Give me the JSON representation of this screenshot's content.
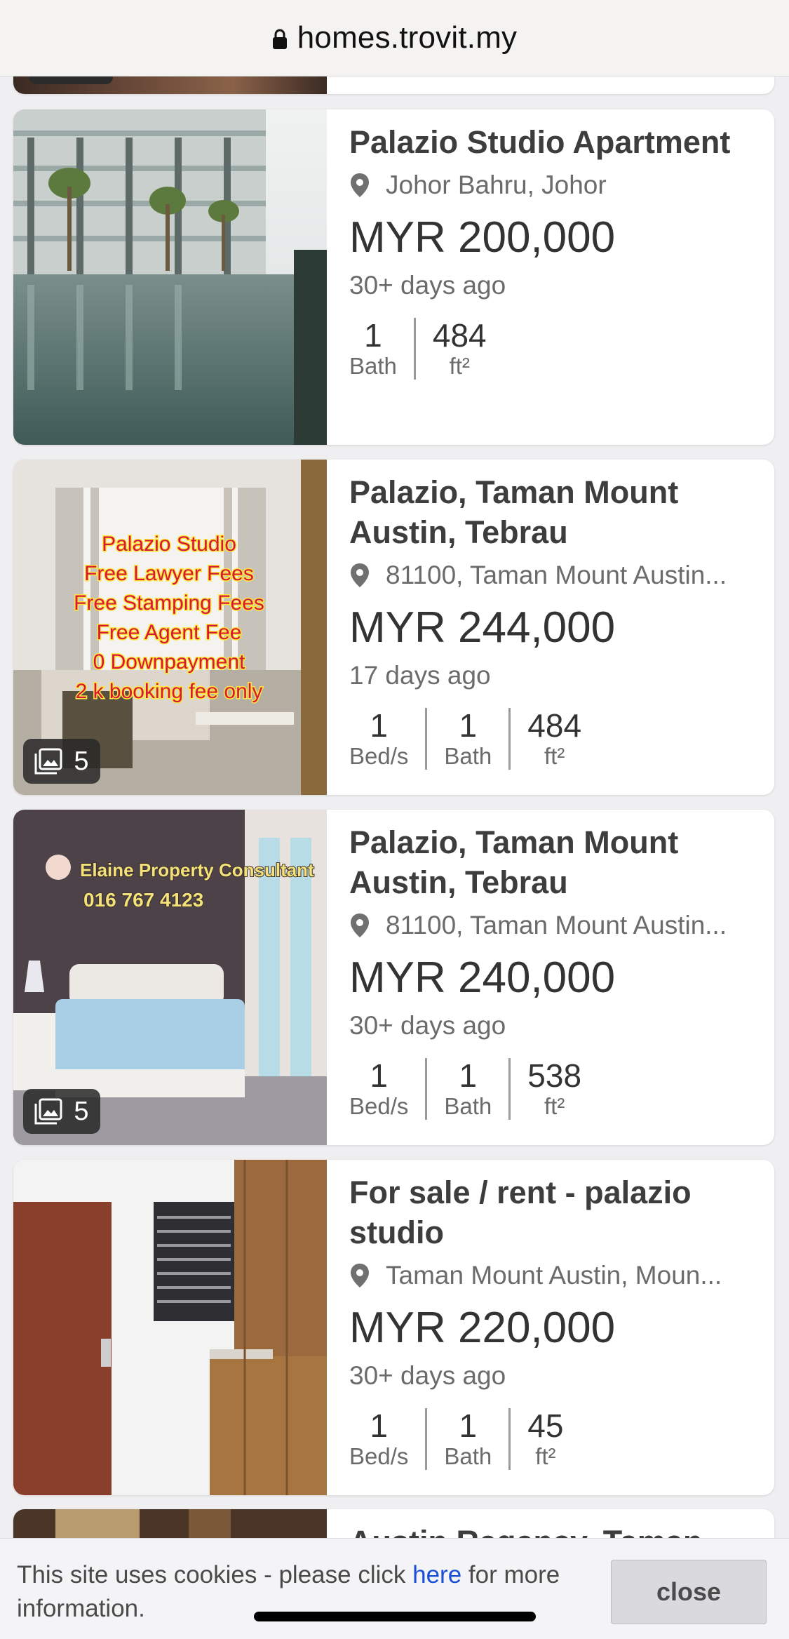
{
  "browser": {
    "url": "homes.trovit.my"
  },
  "listings": [
    {
      "title": "Palazio Studio Apartment",
      "location": "Johor Bahru, Johor",
      "price": "MYR 200,000",
      "date": "30+ days ago",
      "stats": [
        {
          "value": "1",
          "unit": "Bath"
        },
        {
          "value": "484",
          "unit": "ft²"
        }
      ]
    },
    {
      "title": "Palazio, Taman Mount Austin, Tebrau",
      "location": "81100, Taman Mount Austin...",
      "price": "MYR 244,000",
      "date": "17 days ago",
      "photo_count": "5",
      "photo_text": [
        "Palazio Studio",
        "Free Lawyer Fees",
        "Free Stamping Fees",
        "Free Agent Fee",
        "0 Downpayment",
        "2 k booking fee only"
      ],
      "stats": [
        {
          "value": "1",
          "unit": "Bed/s"
        },
        {
          "value": "1",
          "unit": "Bath"
        },
        {
          "value": "484",
          "unit": "ft²"
        }
      ]
    },
    {
      "title": "Palazio, Taman Mount Austin, Tebrau",
      "location": "81100, Taman Mount Austin...",
      "price": "MYR 240,000",
      "date": "30+ days ago",
      "photo_count": "5",
      "photo_text": [
        "Elaine Property Consultant",
        "016 767 4123"
      ],
      "stats": [
        {
          "value": "1",
          "unit": "Bed/s"
        },
        {
          "value": "1",
          "unit": "Bath"
        },
        {
          "value": "538",
          "unit": "ft²"
        }
      ]
    },
    {
      "title": "For sale / rent - palazio studio",
      "location": "Taman Mount Austin, Moun...",
      "price": "MYR 220,000",
      "date": "30+ days ago",
      "stats": [
        {
          "value": "1",
          "unit": "Bed/s"
        },
        {
          "value": "1",
          "unit": "Bath"
        },
        {
          "value": "45",
          "unit": "ft²"
        }
      ]
    },
    {
      "title": "Austin Regency, Taman"
    }
  ],
  "cookie": {
    "text_before": "This site uses cookies - please click ",
    "link": "here",
    "text_after": " for more information.",
    "close_label": "close"
  },
  "colors": {
    "link": "#1a4fd8",
    "card_bg": "#ffffff",
    "page_bg": "#efeff1"
  }
}
